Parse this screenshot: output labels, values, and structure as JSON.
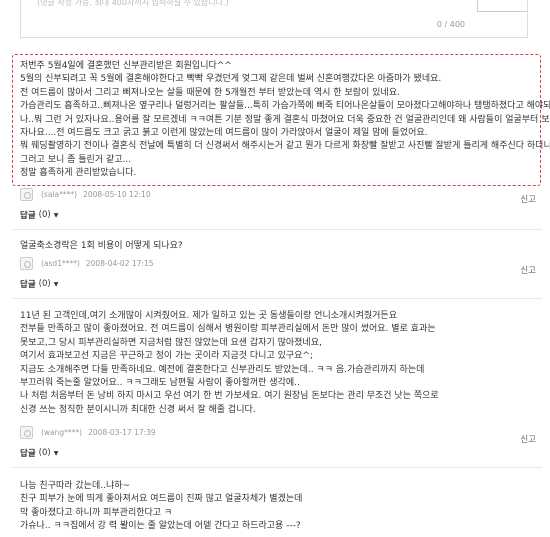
{
  "input": {
    "placeholder": "(댓글 작성 가능, 최대 400자까지 입력하실 수 있습니다.)",
    "counter": "0 / 400"
  },
  "comments": [
    {
      "lines": [
        "저번주 5월4일에 결혼했던 신부관리받은 회원입니다^^",
        "5월의 신부되려고 꼭 5월에 결혼해야한다고 빡빡 우겼던게 엊그제 같은데 벌써 신혼여행갔다온 아줌마가 됐네요.",
        "전 여드름이 많아서 그리고 삐져나오는 살들 때문에 한 5개월전 부터 받았는데 역시 한 보람이 있네요.",
        "가슴관리도 흡족하고..삐져나온 옆구리나 덜렁거리는 팔살들...특히 가슴가쪽에 삐죽 티어나온살들이 모아졌다고해야하나 탱탱하졌다고 해야되",
        "나..뭐 그런 거 있자나요..용어를 잘 모르겠네 ㅋㅋ여튼 기분 정말 좋게 결혼식 마쳤어요 더욱 중요한 건 얼굴관리인데 왜 사람들이 얼굴부터 보",
        "자나요....전 여드름도 크고 굵고 붉고 이런게 많았는데 여드름이 많이 가라앉아서 얼굴이 제일 맘에 들었어요.",
        "뭐 웨딩촬영하기 전이나 결혼식 전날에 특별히 더 신경써서 해주시는거 같고 뭔가 다르게 화장빨 잘받고 사진빨 잘받게 틀리게 해주신다 하더니",
        "그러고 보니 좀 틀린거 같고...",
        "정말 흡족하게 관리받았습니다."
      ],
      "author": "(sala****)",
      "date": "2008-05-10 12:10",
      "reply_label": "답글",
      "reply_count": "(0)",
      "report": "신고"
    },
    {
      "lines": [
        "얼굴축소경락은 1회 비용이 어떻게 되나요?"
      ],
      "author": "(asd1****)",
      "date": "2008-04-02 17:15",
      "reply_label": "답글",
      "reply_count": "(0)",
      "report": "신고"
    },
    {
      "lines": [
        "11년 된 고객인데,여기 소개많이 시켜줬어요. 제가 일하고 있는 곳 동생들이랑 언니소개시켜줬거든요",
        "전부들 만족하고 많이 좋아졌어요. 전 여드름이 심해서 병원이랑 피부관리실에서 돈만 많이 썼어요. 별로 효과는",
        "못보고,그 당시 피부관리실하면 지금처럼 많진 않았는데 요샌 갑자기 많아졌네요,",
        "여기서 효과보고선 지금은 꾸근하고 정이 가는 곳이라 지금것 다니고 있구요^;",
        "지금도 소개해주면 다들 만족하네요. 예전에 결혼한다고 신부관리도 받았는데.. ㅋㅋ 음.가슴관리까지 하는데",
        "부끄러워 죽는줄 알았어요.. ㅋㅋ그래도 남편될 사람이 좋아할꺼란 생각에..",
        "나 처럼 처음부터 돈 낭비 하지 마시고 우선 여기 한 번 가보세요. 여기 원장님 돈보다는 관리 무조건 낫는 쪽으로",
        "신경 쓰는 정직한 분이시니까 최대한 신경 써서 잘 해줄 겁니다."
      ],
      "author": "(wang****)",
      "date": "2008-03-17 17:39",
      "reply_label": "답글",
      "reply_count": "(0)",
      "report": "신고"
    },
    {
      "lines": [
        "나능 친구따라 갔는데..냐하~",
        "친구 피부가 눈에 띄게 좋아져서요 여드름이 진짜 많고 얼굴자체가 별겠는데",
        "막 좋아졌다고 하니까 피부관리한다고 ㅋ",
        "가슈나.. ㅋㅋ집에서 강 력 봘이는 줄 알았는데 어뎉 간다고 하드라고용 ---?"
      ]
    }
  ]
}
